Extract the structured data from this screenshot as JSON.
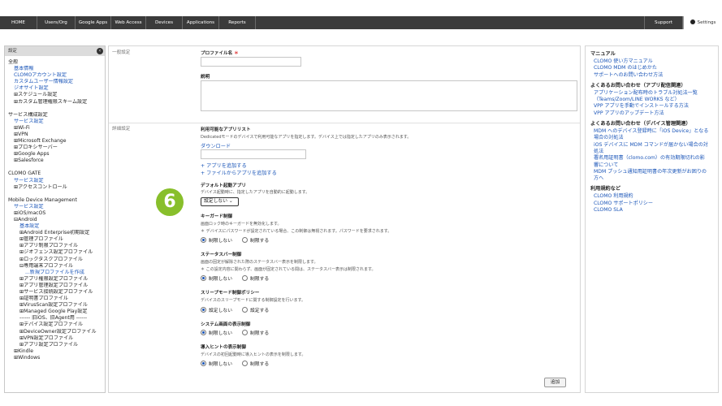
{
  "nav": {
    "tabs": [
      "HOME",
      "Users/Org",
      "Google Apps",
      "Web Access",
      "Devices",
      "Applications",
      "Reports"
    ],
    "support": "Support",
    "settings": "Settings"
  },
  "sidebar": {
    "header": "設定",
    "lines": [
      {
        "text": "全般",
        "kind": "blk",
        "indent": 0
      },
      {
        "text": "基本情報",
        "kind": "lnk",
        "indent": 1
      },
      {
        "text": "CLOMOアカウント設定",
        "kind": "lnk",
        "indent": 1
      },
      {
        "text": "カスタムユーザー情報設定",
        "kind": "lnk",
        "indent": 1
      },
      {
        "text": "ジオサイト設定",
        "kind": "lnk",
        "indent": 1
      },
      {
        "text": "⊞スケジュール設定",
        "kind": "blk",
        "indent": 1
      },
      {
        "text": "⊞カスタム管理権限スキーム設定",
        "kind": "blk",
        "indent": 1
      },
      {
        "text": "",
        "kind": "gap",
        "indent": 0
      },
      {
        "text": "サービス構成設定",
        "kind": "blk",
        "indent": 0
      },
      {
        "text": "サービス設定",
        "kind": "lnk",
        "indent": 1
      },
      {
        "text": "⊞Wi-Fi",
        "kind": "blk",
        "indent": 1
      },
      {
        "text": "⊞VPN",
        "kind": "blk",
        "indent": 1
      },
      {
        "text": "⊞Microsoft Exchange",
        "kind": "blk",
        "indent": 1
      },
      {
        "text": "⊞プロキシサーバー",
        "kind": "blk",
        "indent": 1
      },
      {
        "text": "⊞Google Apps",
        "kind": "blk",
        "indent": 1
      },
      {
        "text": "⊞Salesforce",
        "kind": "blk",
        "indent": 1
      },
      {
        "text": "",
        "kind": "gap",
        "indent": 0
      },
      {
        "text": "CLOMO GATE",
        "kind": "blk",
        "indent": 0
      },
      {
        "text": "サービス設定",
        "kind": "lnk",
        "indent": 1
      },
      {
        "text": "⊞アクセスコントロール",
        "kind": "blk",
        "indent": 1
      },
      {
        "text": "",
        "kind": "gap",
        "indent": 0
      },
      {
        "text": "Mobile Device Management",
        "kind": "blk",
        "indent": 0
      },
      {
        "text": "サービス設定",
        "kind": "lnk",
        "indent": 1
      },
      {
        "text": "⊞iOS/macOS",
        "kind": "blk",
        "indent": 1
      },
      {
        "text": "⊟Android",
        "kind": "blk",
        "indent": 1
      },
      {
        "text": "基本設定",
        "kind": "lnk",
        "indent": 2
      },
      {
        "text": "⊞Android Enterprise初期設定",
        "kind": "blk",
        "indent": 2
      },
      {
        "text": "⊞管理プロファイル",
        "kind": "blk",
        "indent": 2
      },
      {
        "text": "⊞アプリ制限プロファイル",
        "kind": "blk",
        "indent": 2
      },
      {
        "text": "⊞ジオフェンス設定プロファイル",
        "kind": "blk",
        "indent": 2
      },
      {
        "text": "⊞ロックタスクプロファイル",
        "kind": "blk",
        "indent": 2
      },
      {
        "text": "⊟専用端末プロファイル",
        "kind": "blk",
        "indent": 2
      },
      {
        "text": "...新規プロファイルを作成",
        "kind": "lnk",
        "indent": 3
      },
      {
        "text": "⊞アプリ権限設定プロファイル",
        "kind": "blk",
        "indent": 2
      },
      {
        "text": "⊞アプリ管理設定プロファイル",
        "kind": "blk",
        "indent": 2
      },
      {
        "text": "⊞サービス接続設定プロファイル",
        "kind": "blk",
        "indent": 2
      },
      {
        "text": "⊞証明書プロファイル",
        "kind": "blk",
        "indent": 2
      },
      {
        "text": "⊞VirusScan設定プロファイル",
        "kind": "blk",
        "indent": 2
      },
      {
        "text": "⊞Managed Google Play設定",
        "kind": "blk",
        "indent": 2
      },
      {
        "text": "------ 旧iOS、旧Agent用 ------",
        "kind": "blk",
        "indent": 2
      },
      {
        "text": "⊞デバイス設定プロファイル",
        "kind": "blk",
        "indent": 2
      },
      {
        "text": "⊞DeviceOwner設定プロファイル",
        "kind": "blk",
        "indent": 2
      },
      {
        "text": "⊞VPN設定プロファイル",
        "kind": "blk",
        "indent": 2
      },
      {
        "text": "⊞アプリ設定プロファイル",
        "kind": "blk",
        "indent": 2
      },
      {
        "text": "⊞Kindle",
        "kind": "blk",
        "indent": 1
      },
      {
        "text": "⊞Windows",
        "kind": "blk",
        "indent": 1
      }
    ]
  },
  "main": {
    "general_label": "一般設定",
    "profile_name_label": "プロファイル名",
    "required_mark": "＊",
    "description_label": "説明",
    "detail_label": "詳細設定",
    "apps_label": "利用可能なアプリリスト",
    "apps_desc": "Dedicatedモードのデバイスで利用可能なアプリを指定します。デバイス上では指定したアプリのみ表示されます。",
    "download_link": "ダウンロード",
    "add_app_link": "+ アプリを追加する",
    "add_file_link": "+ ファイルからアプリを追加する",
    "default_app_label": "デフォルト起動アプリ",
    "default_app_desc": "デバイス起動時に、指定したアプリを自動的に起動します。",
    "default_app_select": "設定しない",
    "step_badge": "6",
    "keyguard_label": "キーガード制御",
    "keyguard_desc1": "画面ロック時のキーガードを無効化します。",
    "keyguard_desc2": "＊ デバイスにパスワードが設定されている場合、この制御は無視されます。パスワードを要求されます。",
    "keyguard_opts": [
      "制限しない",
      "制限する"
    ],
    "statusbar_label": "ステータスバー制御",
    "statusbar_desc1": "画面の固定が解除された際のステータスバー表示を制限します。",
    "statusbar_desc2": "＊ この設定内容に関わらず、画面が固定されている間は、ステータスバー表示は制限されます。",
    "statusbar_opts": [
      "制限しない",
      "制限する"
    ],
    "sleep_label": "スリープモード制御ポリシー",
    "sleep_desc": "デバイスのスリープモードに関する制御設定を行います。",
    "sleep_opts": [
      "設定しない",
      "設定する"
    ],
    "sysui_label": "システム画面の表示制御",
    "sysui_opts": [
      "制限しない",
      "制限する"
    ],
    "hint_label": "導入ヒントの表示制御",
    "hint_desc": "デバイスの初回起動時に導入ヒントの表示を制限します。",
    "hint_opts": [
      "制限しない",
      "制限する"
    ],
    "add_button": "追加"
  },
  "right": {
    "sections": [
      {
        "title": "マニュアル",
        "links": [
          "CLOMO 使い方マニュアル",
          "CLOMO MDM のはじめかた",
          "サポートへのお問い合わせ方法"
        ]
      },
      {
        "title": "よくあるお問い合わせ（アプリ配信関連）",
        "links": [
          "アプリケーション配布時のトラブル対処法一覧",
          "（Teams/Zoom/LINE WORKS など）",
          "VPP アプリを手動でインストールする方法",
          "VPP アプリのアップデート方法"
        ]
      },
      {
        "title": "よくあるお問い合わせ（デバイス管理関連）",
        "links": [
          "MDM へのデバイス登録時に「iOS Device」となる",
          "場合の対処法",
          "iOS デバイスに MDM コマンドが届かない場合の対",
          "処法",
          "署名用証明書（clomo.com）の有効期限切れの影",
          "響について",
          "MDM プッシュ通知用証明書の年次更新がお困りの",
          "方へ"
        ]
      },
      {
        "title": "利用規約など",
        "links": [
          "CLOMO 利用規約",
          "CLOMO サポートポリシー",
          "CLOMO SLA"
        ]
      }
    ]
  }
}
